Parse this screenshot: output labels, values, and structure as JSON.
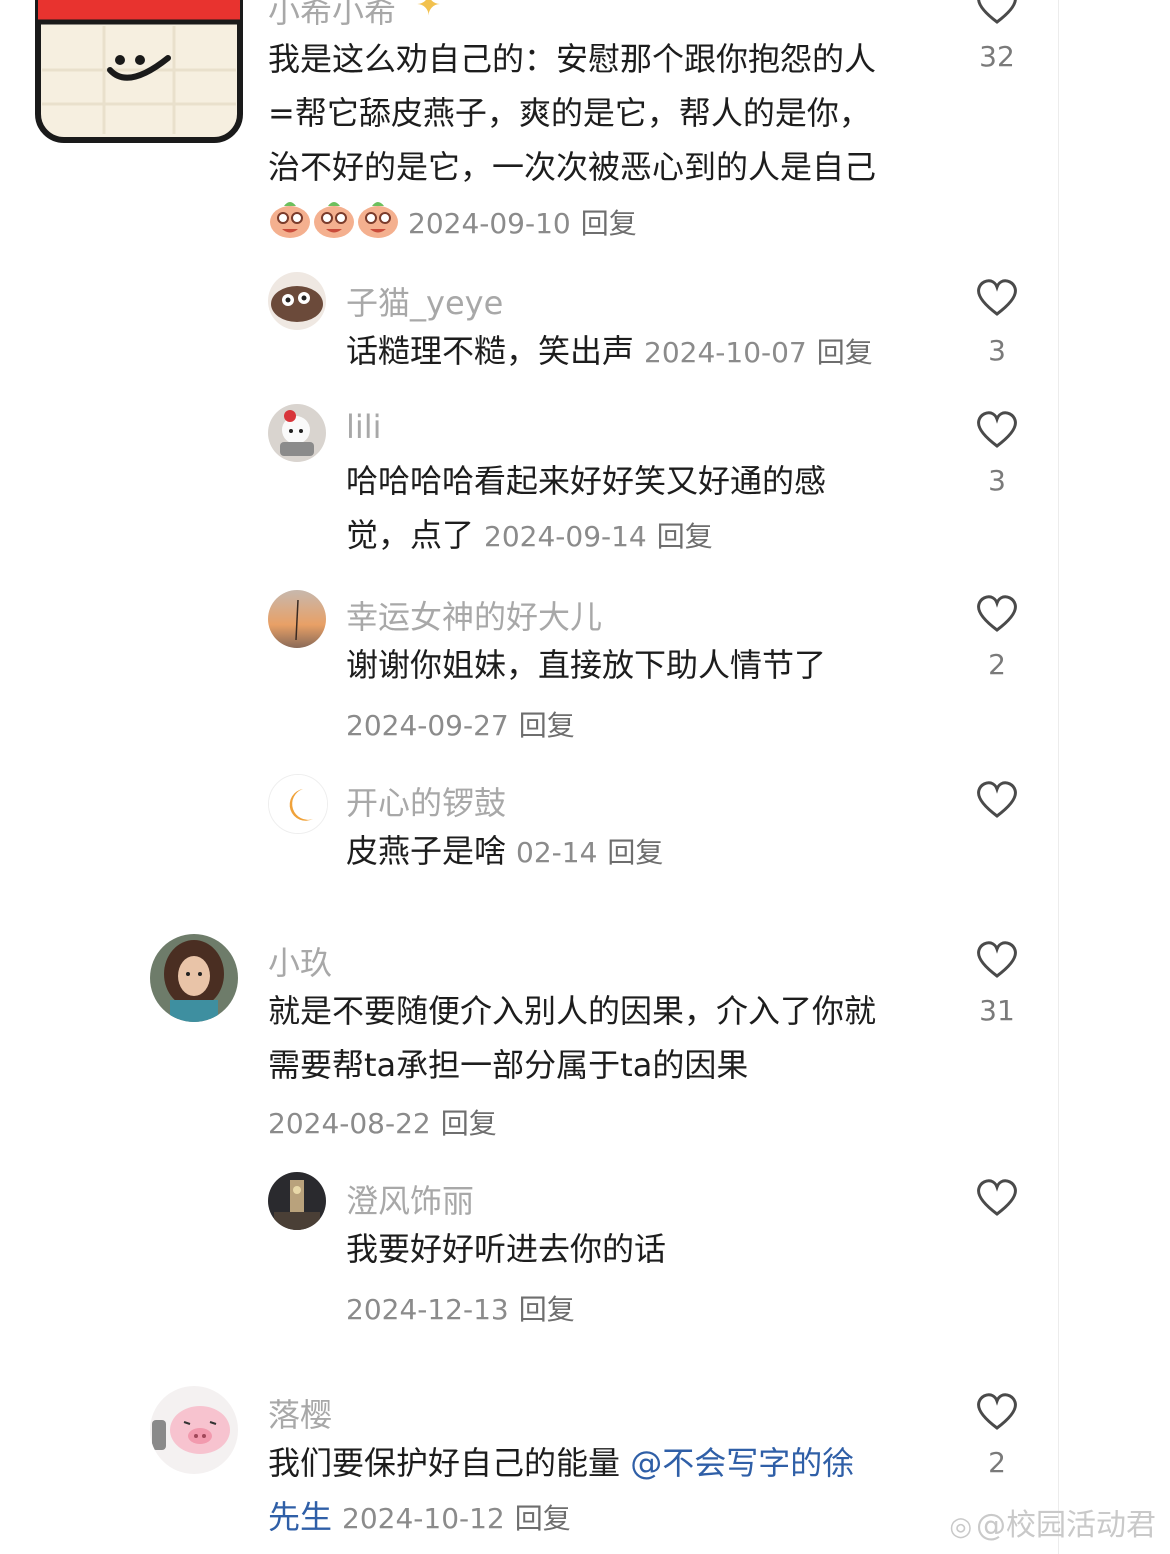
{
  "comments": [
    {
      "user": "小希小希",
      "lines": [
        "我是这么劝自己的：安慰那个跟你抱怨的人",
        "=帮它舔皮燕子，爽的是它，帮人的是你，",
        "治不好的是它，一次次被恶心到的人是自己"
      ],
      "date": "2024-09-10",
      "reply": "回复",
      "likes": "32"
    },
    {
      "user": "子猫_yeye",
      "lines": [
        "话糙理不糙，笑出声"
      ],
      "date": "2024-10-07",
      "reply": "回复",
      "likes": "3"
    },
    {
      "user": "lili",
      "lines": [
        "哈哈哈哈看起来好好笑又好通的感",
        "觉，点了"
      ],
      "date": "2024-09-14",
      "reply": "回复",
      "likes": "3"
    },
    {
      "user": "幸运女神的好大儿",
      "lines": [
        "谢谢你姐妹，直接放下助人情节了"
      ],
      "date": "2024-09-27",
      "reply": "回复",
      "likes": "2"
    },
    {
      "user": "开心的锣鼓",
      "lines": [
        "皮燕子是啥"
      ],
      "date": "02-14",
      "reply": "回复"
    },
    {
      "user": "小玖",
      "lines": [
        "就是不要随便介入别人的因果，介入了你就",
        "需要帮ta承担一部分属于ta的因果"
      ],
      "date": "2024-08-22",
      "reply": "回复",
      "likes": "31"
    },
    {
      "user": "澄风饰丽",
      "lines": [
        "我要好好听进去你的话"
      ],
      "date": "2024-12-13",
      "reply": "回复"
    },
    {
      "user": "落樱",
      "lines": [
        "我们要保护好自己的能量 ",
        "先生"
      ],
      "mention_part1": "@不会写字的徐",
      "date": "2024-10-12",
      "reply": "回复",
      "likes": "2"
    }
  ],
  "watermark": "@校园活动君",
  "sticker": {
    "icon": "calendar-smile-icon",
    "accent": "#e8332f"
  },
  "colors": {
    "name": "#a8a8a8",
    "text": "#1d1d1d",
    "meta": "#8b8b8b",
    "mention": "#2f5fa7"
  }
}
